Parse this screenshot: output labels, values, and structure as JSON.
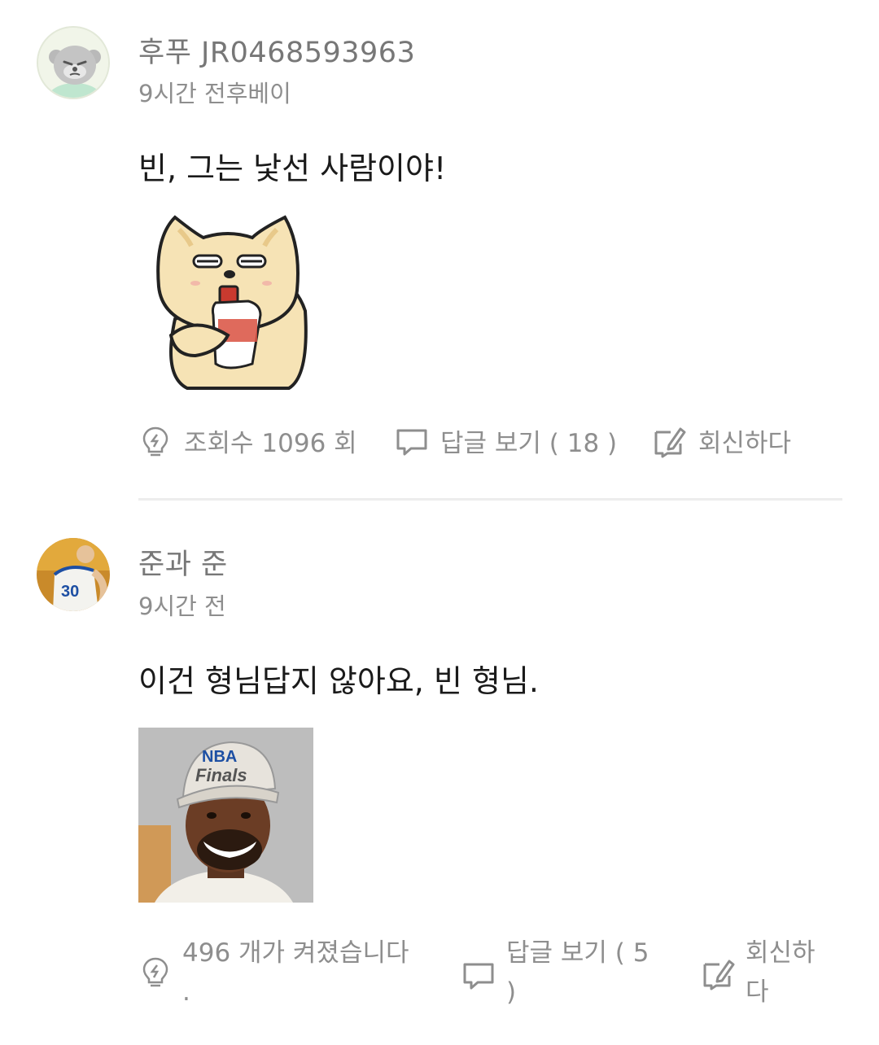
{
  "comments": [
    {
      "author": "후푸 JR0468593963",
      "meta": "9시간 전후베이",
      "text": "빈, 그는 낯선 사람이야!",
      "sticker": "dog-drinking-sticker",
      "views_label": "조회수 1096 회",
      "replies_label": "답글 보기 ( 18 )",
      "reply_label": "회신하다"
    },
    {
      "author": "준과 준",
      "meta": "9시간 전",
      "text": "이건 형님답지 않아요, 빈 형님.",
      "sticker": "nba-finals-cap-photo",
      "views_label_line1": "496 개가 켜졌습니다",
      "views_label_line2": ".",
      "replies_label_line1": "답글 보기 ( 5",
      "replies_label_line2": ")",
      "reply_label_line1": "회신하",
      "reply_label_line2": "다"
    }
  ],
  "icons": {
    "views": "lightbulb-icon",
    "replies": "speech-bubble-icon",
    "reply": "edit-icon"
  },
  "colors": {
    "text_primary": "#1a1a1a",
    "text_muted": "#8e8e8e",
    "divider": "#ededed"
  }
}
